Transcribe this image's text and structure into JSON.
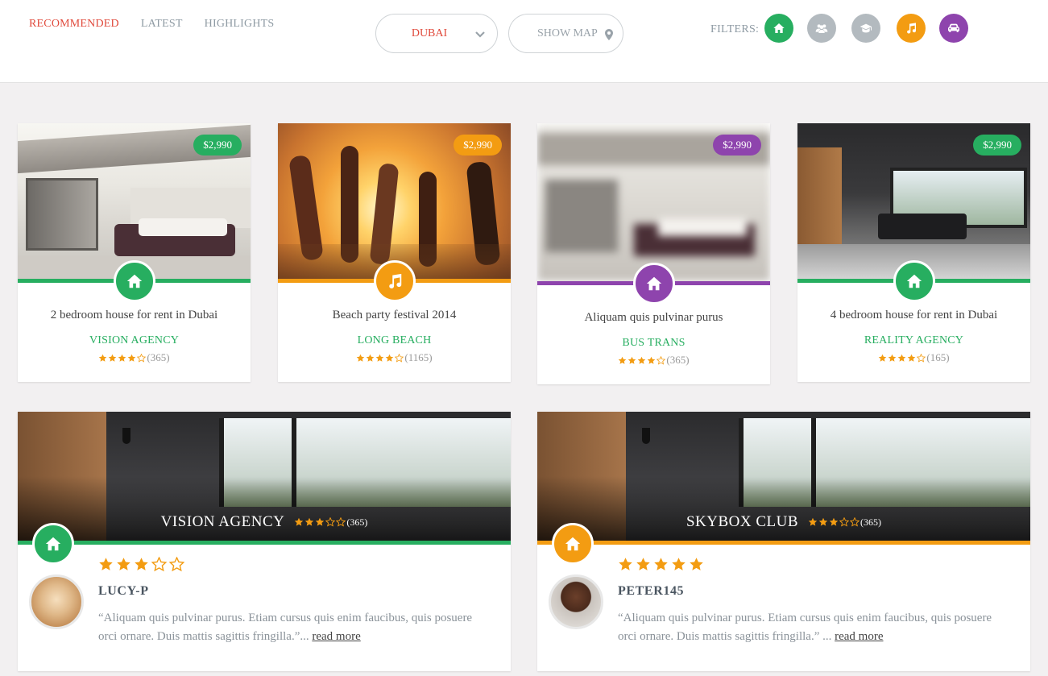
{
  "tabs": [
    {
      "label": "RECOMMENDED",
      "active": true
    },
    {
      "label": "LATEST",
      "active": false
    },
    {
      "label": "HIGHLIGHTS",
      "active": false
    }
  ],
  "city_select": {
    "value": "DUBAI"
  },
  "show_map": {
    "label": "SHOW MAP"
  },
  "filters": {
    "label": "FILTERS:",
    "items": [
      {
        "icon": "home-icon",
        "color": "#27ae60"
      },
      {
        "icon": "group-icon",
        "color": "#b3babf"
      },
      {
        "icon": "graduation-cap-icon",
        "color": "#b3babf"
      },
      {
        "icon": "music-icon",
        "color": "#f39c12"
      },
      {
        "icon": "car-icon",
        "color": "#8e44ad"
      }
    ]
  },
  "listings": [
    {
      "price": "$2,990",
      "color": "#27ae60",
      "icon": "home-icon",
      "title": "2 bedroom house for rent in Dubai",
      "agency": "VISION AGENCY",
      "rating": 4,
      "count": "(365)"
    },
    {
      "price": "$2,990",
      "color": "#f39c12",
      "icon": "music-icon",
      "title": "Beach party festival 2014",
      "agency": "LONG BEACH",
      "rating": 4,
      "count": "(1165)"
    },
    {
      "price": "$2,990",
      "color": "#8e44ad",
      "icon": "home-icon",
      "title": "Aliquam quis pulvinar purus",
      "agency": "BUS TRANS",
      "rating": 4,
      "count": "(365)"
    },
    {
      "price": "$2,990",
      "color": "#27ae60",
      "icon": "home-icon",
      "title": "4 bedroom house for rent in Dubai",
      "agency": "REALITY AGENCY",
      "rating": 4,
      "count": "(165)"
    }
  ],
  "reviews": [
    {
      "venue": "VISION AGENCY",
      "venue_rating": 3,
      "venue_count": "(365)",
      "color": "#27ae60",
      "icon": "home-icon",
      "user_rating": 3,
      "user": "LUCY-P",
      "quote": "“Aliquam quis pulvinar purus. Etiam cursus quis enim faucibus, quis posuere orci ornare. Duis mattis sagittis fringilla.”...",
      "read_more": "read more"
    },
    {
      "venue": "SKYBOX CLUB",
      "venue_rating": 3,
      "venue_count": "(365)",
      "color": "#f39c12",
      "icon": "home-icon",
      "user_rating": 5,
      "user": "PETER145",
      "quote": "“Aliquam quis pulvinar purus. Etiam cursus quis enim faucibus, quis posuere orci ornare. Duis mattis sagittis fringilla.” ...",
      "read_more": "read more"
    }
  ],
  "star_color": "#f39c12"
}
